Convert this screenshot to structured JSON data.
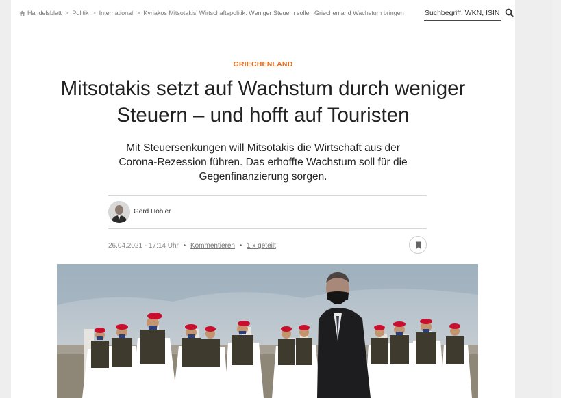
{
  "breadcrumb": {
    "items": [
      "Handelsblatt",
      "Politik",
      "International",
      "Kyriakos Mitsotakis' Wirtschaftspolitik: Weniger Steuern sollen Griechenland Wachstum bringen"
    ],
    "separator": ">"
  },
  "search": {
    "placeholder": "Suchbegriff, WKN, ISIN"
  },
  "article": {
    "kicker": "GRIECHENLAND",
    "headline": "Mitsotakis setzt auf Wachstum durch weniger Steuern – und hofft auf Touristen",
    "lead": "Mit Steuersenkungen will Mitsotakis die Wirtschaft aus der Corona-Rezession führen. Das erhoffte Wachstum soll für die Gegenfinanzierung sorgen.",
    "author": "Gerd Höhler",
    "date": "26.04.2021 - 17:14 Uhr",
    "comments_label": "Kommentieren",
    "shared_label": "1 x geteilt",
    "bullet": "•"
  },
  "colors": {
    "kicker": "#e26b1f",
    "text": "#222222",
    "muted": "#888888"
  },
  "icons": {
    "home": "home-icon",
    "search": "search-icon",
    "bookmark": "bookmark-icon"
  }
}
